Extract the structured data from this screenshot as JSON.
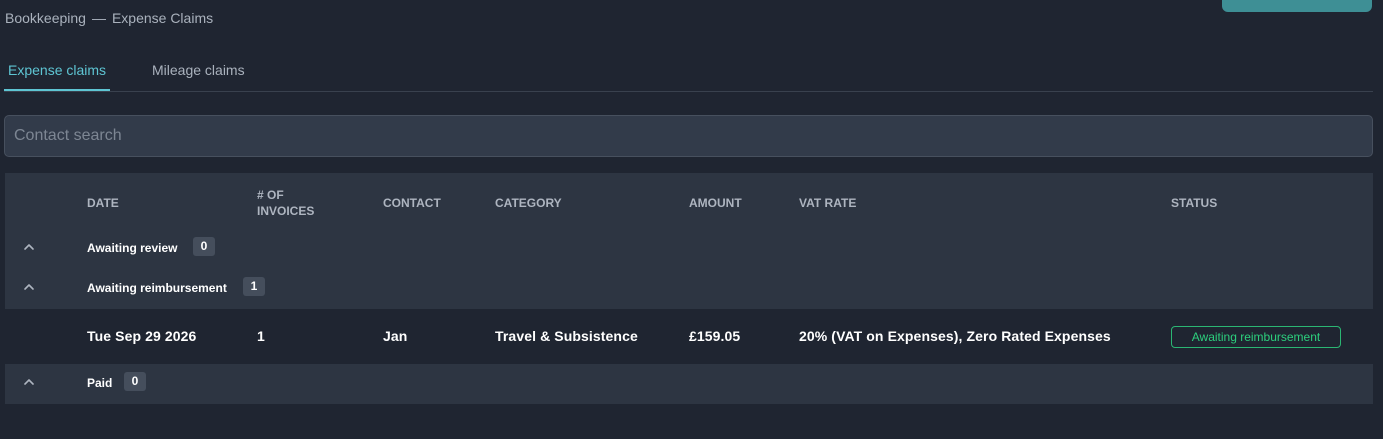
{
  "breadcrumb": {
    "parent": "Bookkeeping",
    "separator": "—",
    "current": "Expense Claims"
  },
  "tabs": [
    {
      "label": "Expense claims",
      "active": true
    },
    {
      "label": "Mileage claims",
      "active": false
    }
  ],
  "search": {
    "placeholder": "Contact search",
    "value": ""
  },
  "table": {
    "columns": {
      "date": "DATE",
      "invoices_line1": "# OF",
      "invoices_line2": "INVOICES",
      "contact": "CONTACT",
      "category": "CATEGORY",
      "amount": "AMOUNT",
      "vat_rate": "VAT RATE",
      "status": "STATUS"
    },
    "groups": [
      {
        "label": "Awaiting review",
        "count": "0",
        "expanded": true
      },
      {
        "label": "Awaiting reimbursement",
        "count": "1",
        "expanded": true,
        "rows": [
          {
            "date": "Tue Sep 29 2026",
            "invoices": "1",
            "contact": "Jan",
            "category": "Travel & Subsistence",
            "amount": "£159.05",
            "vat_rate": "20% (VAT on Expenses), Zero Rated Expenses",
            "status": "Awaiting reimbursement"
          }
        ]
      },
      {
        "label": "Paid",
        "count": "0",
        "expanded": true
      }
    ]
  },
  "colors": {
    "background": "#1f2531",
    "panel": "#2d3542",
    "accent": "#5ec5d3",
    "button": "#3e8f95",
    "status_green": "#2ccf7d"
  },
  "icons": {
    "group_toggle": "chevron-up-icon"
  }
}
